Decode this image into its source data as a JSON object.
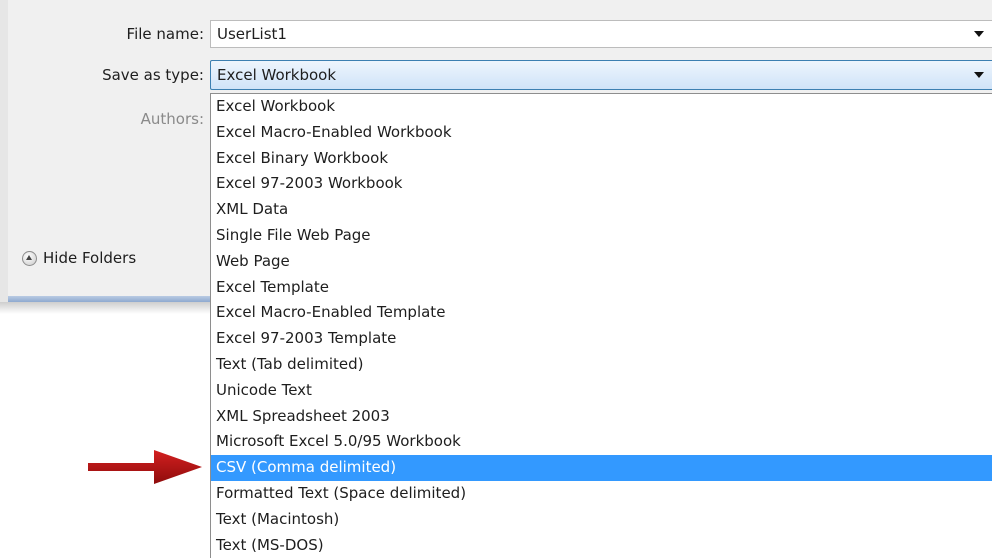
{
  "dialog": {
    "file_name_label": "File name:",
    "file_name_value": "UserList1",
    "save_as_type_label": "Save as type:",
    "save_as_type_value": "Excel Workbook",
    "authors_label": "Authors:",
    "hide_folders_label": "Hide Folders"
  },
  "file_types": [
    "Excel Workbook",
    "Excel Macro-Enabled Workbook",
    "Excel Binary Workbook",
    "Excel 97-2003 Workbook",
    "XML Data",
    "Single File Web Page",
    "Web Page",
    "Excel Template",
    "Excel Macro-Enabled Template",
    "Excel 97-2003 Template",
    "Text (Tab delimited)",
    "Unicode Text",
    "XML Spreadsheet 2003",
    "Microsoft Excel 5.0/95 Workbook",
    "CSV (Comma delimited)",
    "Formatted Text (Space delimited)",
    "Text (Macintosh)",
    "Text (MS-DOS)"
  ],
  "selected_index": 14,
  "icons": {
    "dropdown": "chevron-down-icon",
    "hide_folders": "collapse-up-icon",
    "annotation": "red-arrow-icon"
  },
  "colors": {
    "selection": "#3399ff",
    "annotation_arrow": "#b01414",
    "dialog_background": "#f0f0f0"
  }
}
